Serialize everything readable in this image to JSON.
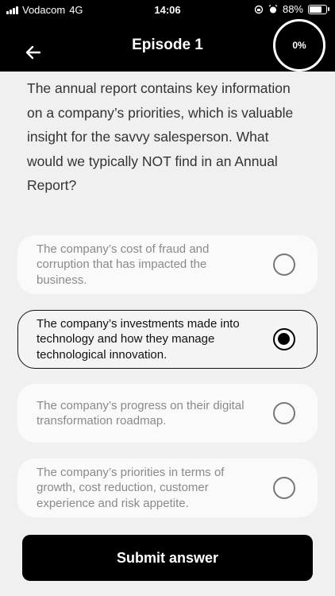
{
  "status_bar": {
    "carrier": "Vodacom",
    "network": "4G",
    "time": "14:06",
    "battery": "88%",
    "battery_level": 0.88
  },
  "header": {
    "title": "Episode 1",
    "progress": "0%",
    "back_icon": "arrow-left-icon"
  },
  "question": "The annual report contains key information on a company’s priorities, which is valuable insight for the savvy salesperson. What would we typically NOT find in an Annual Report?",
  "options": [
    {
      "text": "The company’s cost of fraud and corruption that has impacted the business.",
      "selected": false
    },
    {
      "text": "The company’s investments made into technology and how they manage technological innovation.",
      "selected": true
    },
    {
      "text": "The company’s progress on their digital transformation roadmap.",
      "selected": false
    },
    {
      "text": "The company’s priorities in terms of growth, cost reduction, customer experience and risk appetite.",
      "selected": false
    }
  ],
  "submit_label": "Submit answer"
}
